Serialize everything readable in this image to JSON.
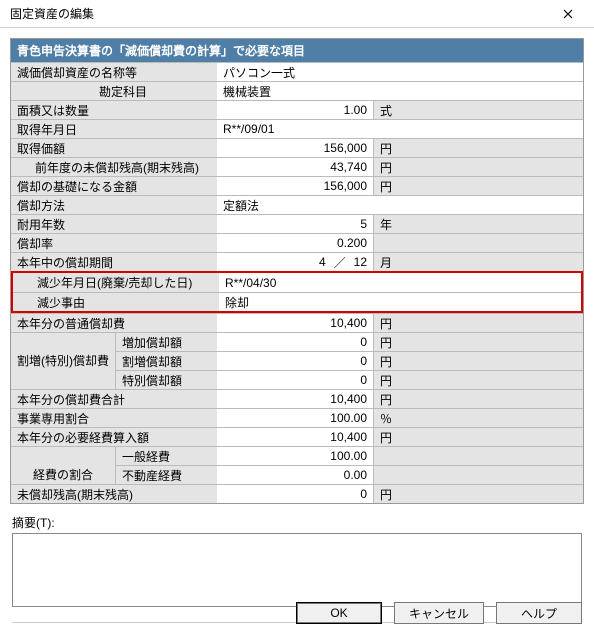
{
  "window": {
    "title": "固定資産の編集"
  },
  "section": {
    "header": "青色申告決算書の「減価償却費の計算」で必要な項目"
  },
  "rows": {
    "asset_name_label": "減価償却資産の名称等",
    "asset_name_value": "パソコン一式",
    "account_label": "勘定科目",
    "account_value": "機械装置",
    "area_qty_label": "面積又は数量",
    "area_qty_value": "1.00",
    "area_qty_unit": "式",
    "acq_date_label": "取得年月日",
    "acq_date_value": "R**/09/01",
    "acq_price_label": "取得価額",
    "acq_price_value": "156,000",
    "acq_price_unit": "円",
    "prev_balance_label": "前年度の未償却残高(期末残高)",
    "prev_balance_value": "43,740",
    "prev_balance_unit": "円",
    "base_amount_label": "償却の基礎になる金額",
    "base_amount_value": "156,000",
    "base_amount_unit": "円",
    "method_label": "償却方法",
    "method_value": "定額法",
    "life_label": "耐用年数",
    "life_value": "5",
    "life_unit": "年",
    "rate_label": "償却率",
    "rate_value": "0.200",
    "period_label": "本年中の償却期間",
    "period_num": "4",
    "period_den": "12",
    "period_sep": "／",
    "period_unit": "月",
    "decrease_date_label": "減少年月日(廃棄/売却した日)",
    "decrease_date_value": "R**/04/30",
    "decrease_reason_label": "減少事由",
    "decrease_reason_value": "除却",
    "ordinary_dep_label": "本年分の普通償却費",
    "ordinary_dep_value": "10,400",
    "ordinary_dep_unit": "円",
    "special_group_label": "割増(特別)償却費",
    "increase_label": "増加償却額",
    "increase_value": "0",
    "increase_unit": "円",
    "extra_label": "割増償却額",
    "extra_value": "0",
    "extra_unit": "円",
    "special_label": "特別償却額",
    "special_value": "0",
    "special_unit": "円",
    "total_dep_label": "本年分の償却費合計",
    "total_dep_value": "10,400",
    "total_dep_unit": "円",
    "biz_ratio_label": "事業専用割合",
    "biz_ratio_value": "100.00",
    "biz_ratio_unit": "％",
    "expense_label": "本年分の必要経費算入額",
    "expense_value": "10,400",
    "expense_unit": "円",
    "exp_ratio_label": "経費の割合",
    "general_exp_label": "一般経費",
    "general_exp_value": "100.00",
    "realestate_exp_label": "不動産経費",
    "realestate_exp_value": "0.00",
    "remaining_label": "未償却残高(期末残高)",
    "remaining_value": "0",
    "remaining_unit": "円"
  },
  "summary": {
    "label": "摘要(T):"
  },
  "buttons": {
    "ok": "OK",
    "cancel": "キャンセル",
    "help": "ヘルプ"
  }
}
